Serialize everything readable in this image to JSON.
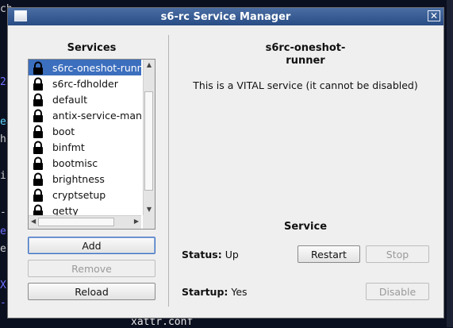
{
  "window": {
    "title": "s6-rc Service Manager"
  },
  "background_text": {
    "line1": "ch",
    "line2": "2",
    "line3": "ea",
    "line4": "h1",
    "line5": "iz",
    "line6": "-",
    "line7": "el",
    "line8": "el",
    "line9": "Xi",
    "line10": "-1",
    "line11": "xattr.conf"
  },
  "services_panel": {
    "heading": "Services",
    "items": [
      {
        "label": "s6rc-oneshot-runner",
        "icon": "lock-icon",
        "selected": true
      },
      {
        "label": "s6rc-fdholder",
        "icon": "lock-icon"
      },
      {
        "label": "default",
        "icon": "lock-icon"
      },
      {
        "label": "antix-service-manager",
        "icon": "lock-icon"
      },
      {
        "label": "boot",
        "icon": "lock-icon"
      },
      {
        "label": "binfmt",
        "icon": "lock-icon"
      },
      {
        "label": "bootmisc",
        "icon": "lock-icon"
      },
      {
        "label": "brightness",
        "icon": "lock-icon"
      },
      {
        "label": "cryptsetup",
        "icon": "lock-icon"
      },
      {
        "label": "getty",
        "icon": "lock-icon"
      }
    ],
    "add_label": "Add",
    "remove_label": "Remove",
    "reload_label": "Reload"
  },
  "detail": {
    "title_line1": "s6rc-oneshot-",
    "title_line2": "runner",
    "description": "This is a VITAL service (it cannot be disabled)",
    "section_heading": "Service",
    "status_label": "Status:",
    "status_value": "Up",
    "startup_label": "Startup:",
    "startup_value": "Yes",
    "restart_label": "Restart",
    "stop_label": "Stop",
    "disable_label": "Disable"
  },
  "colors": {
    "titlebar": "#3a5e96",
    "selection": "#3c6fbe",
    "desktop": "#0b1020"
  }
}
